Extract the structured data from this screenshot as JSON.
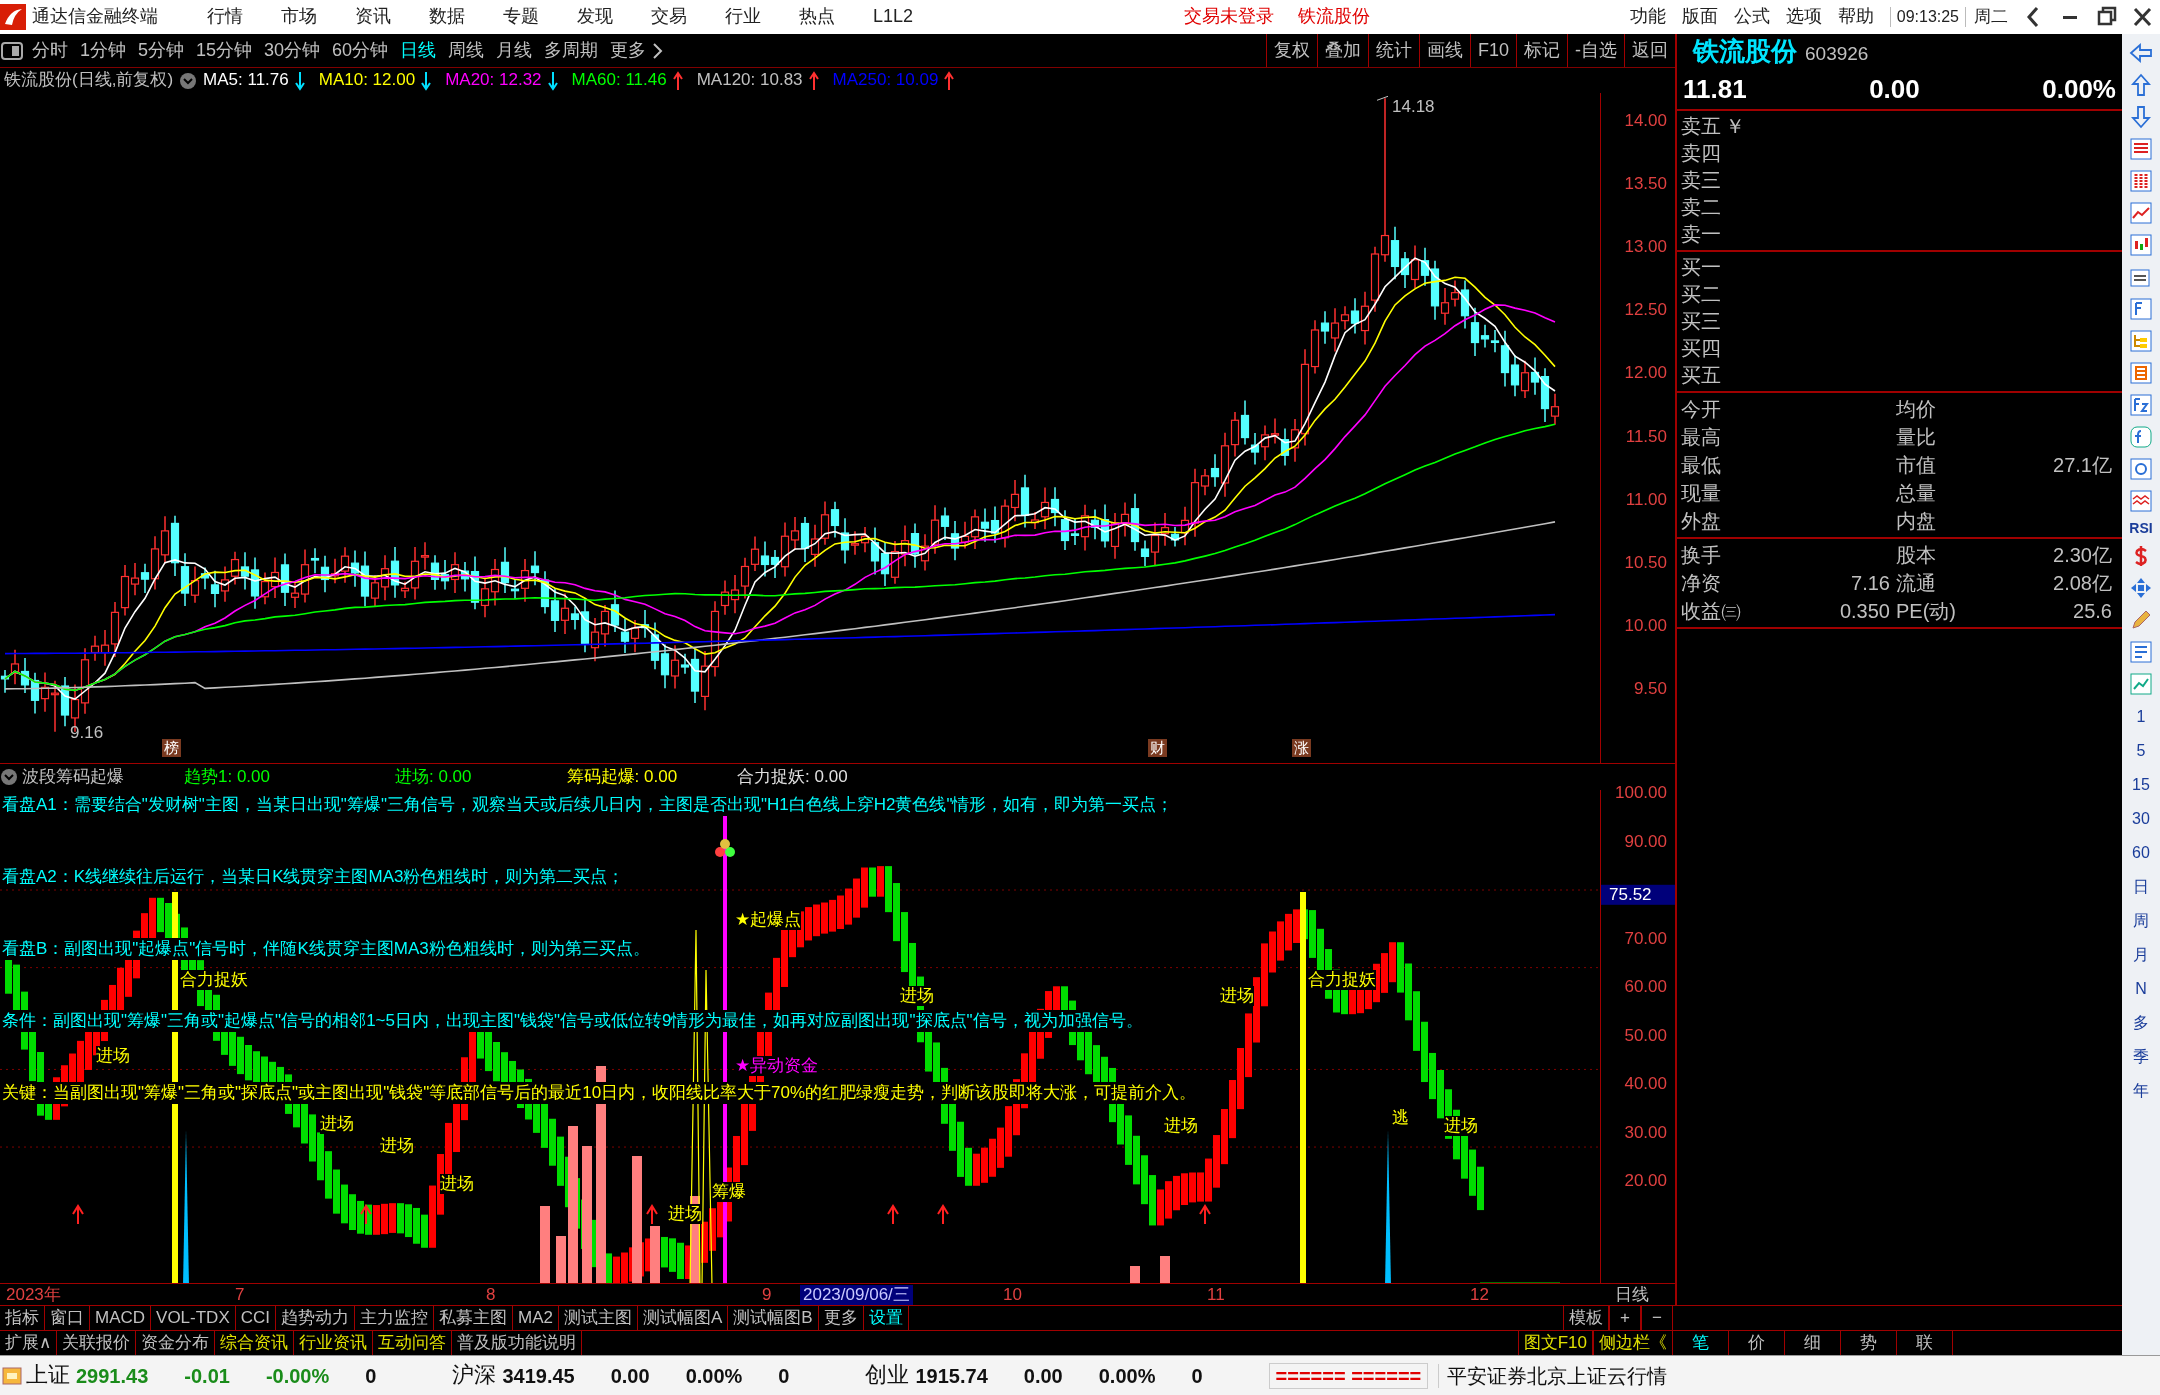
{
  "window": {
    "title": "通达信金融终端",
    "menus": [
      "行情",
      "市场",
      "资讯",
      "数据",
      "专题",
      "发现",
      "交易",
      "行业",
      "热点",
      "L1L2"
    ],
    "notices": [
      "交易未登录",
      "铁流股份"
    ],
    "right_menus": [
      "功能",
      "版面",
      "公式",
      "选项",
      "帮助"
    ],
    "time": "09:13:25",
    "weekday": "周二"
  },
  "period_tabs": [
    {
      "label": "分时",
      "selected": false
    },
    {
      "label": "1分钟",
      "selected": false
    },
    {
      "label": "5分钟",
      "selected": false
    },
    {
      "label": "15分钟",
      "selected": false
    },
    {
      "label": "30分钟",
      "selected": false
    },
    {
      "label": "60分钟",
      "selected": false
    },
    {
      "label": "日线",
      "selected": true
    },
    {
      "label": "周线",
      "selected": false
    },
    {
      "label": "月线",
      "selected": false
    },
    {
      "label": "多周期",
      "selected": false
    },
    {
      "label": "更多",
      "selected": false
    }
  ],
  "chart_tools": [
    "复权",
    "叠加",
    "统计",
    "画线",
    "F10",
    "标记",
    "-自选",
    "返回"
  ],
  "legend": {
    "title": "铁流股份(日线,前复权)",
    "averages": [
      {
        "label": "MA5: 11.76",
        "color": "#ffffff",
        "rising": false
      },
      {
        "label": "MA10: 12.00",
        "color": "#ffff00",
        "rising": false
      },
      {
        "label": "MA20: 12.32",
        "color": "#ff00ff",
        "rising": false
      },
      {
        "label": "MA60: 11.46",
        "color": "#00ff00",
        "rising": true
      },
      {
        "label": "MA120: 10.83",
        "color": "#c0c0c0",
        "rising": true
      },
      {
        "label": "MA250: 10.09",
        "color": "#0000ff",
        "rising": true
      }
    ]
  },
  "price_axis": [
    "14.00",
    "13.50",
    "13.00",
    "12.50",
    "12.00",
    "11.50",
    "11.00",
    "10.50",
    "10.00",
    "9.50"
  ],
  "high_label": "14.18",
  "low_label": "9.16",
  "event_marks": [
    "榜",
    "财",
    "涨"
  ],
  "indicator": {
    "name": "波段筹码起爆",
    "readings": [
      {
        "label": "趋势1: 0.00",
        "color": "#00ff00"
      },
      {
        "label": "进场: 0.00",
        "color": "#00ff00"
      },
      {
        "label": "筹码起爆: 0.00",
        "color": "#ffff00"
      },
      {
        "label": "合力捉妖: 0.00",
        "color": "#e0e0e0"
      }
    ],
    "notes": [
      {
        "text": "看盘A1：需要结合\"发财树\"主图，当某日出现\"筹爆\"三角信号，观察当天或后续几日内，主图是否出现\"H1白色线上穿H2黄色线\"情形，如有，即为第一买点；",
        "color": "#00ffff"
      },
      {
        "text": "看盘A2：K线继续往后运行，当某日K线贯穿主图MA3粉色粗线时，则为第二买点；",
        "color": "#00ffff"
      },
      {
        "text": "看盘B：副图出现\"起爆点\"信号时，伴随K线贯穿主图MA3粉色粗线时，则为第三买点。",
        "color": "#00ffff"
      },
      {
        "text": "条件：副图出现\"筹爆\"三角或\"起爆点\"信号的相邻1~5日内，出现主图\"钱袋\"信号或低位转9情形为最佳，如再对应副图出现\"探底点\"信号，视为加强信号。",
        "color": "#00ffff"
      },
      {
        "text": "关键：当副图出现\"筹爆\"三角或\"探底点\"或主图出现\"钱袋\"等底部信号后的最近10日内，收阳线比率大于70%的红肥绿瘦走势，判断该股即将大涨，可提前介入。",
        "color": "#ffff00"
      }
    ],
    "signals": [
      {
        "text": "合力捉妖",
        "color": "#ffff00"
      },
      {
        "text": "进场",
        "color": "#ffff00"
      },
      {
        "text": "进场",
        "color": "#ffff00"
      },
      {
        "text": "进场",
        "color": "#ffff00"
      },
      {
        "text": "进场",
        "color": "#ffff00"
      },
      {
        "text": "筹爆",
        "color": "#ffff00"
      },
      {
        "text": "进场",
        "color": "#ffff00"
      },
      {
        "text": "★起爆点",
        "color": "#ffff00"
      },
      {
        "text": "★异动资金",
        "color": "#ff00ff"
      },
      {
        "text": "进场",
        "color": "#ffff00"
      },
      {
        "text": "进场",
        "color": "#ffff00"
      },
      {
        "text": "进场",
        "color": "#ffff00"
      },
      {
        "text": "合力捉妖",
        "color": "#ffff00"
      },
      {
        "text": "逃",
        "color": "#ffff00"
      },
      {
        "text": "进场",
        "color": "#ffff00"
      }
    ],
    "axis": [
      "100.00",
      "90.00",
      "70.00",
      "60.00",
      "50.00",
      "40.00",
      "30.00",
      "20.00"
    ],
    "current": "75.52"
  },
  "date_axis": {
    "labels": [
      "2023年",
      "7",
      "8",
      "9",
      "10",
      "11",
      "12"
    ],
    "cursor_date": "2023/09/06/三",
    "period": "日线"
  },
  "bottom_tabs": [
    {
      "label": "指标",
      "kind": "tab"
    },
    {
      "label": "窗口",
      "kind": "tab"
    },
    {
      "label": "MACD",
      "kind": "tab"
    },
    {
      "label": "VOL-TDX",
      "kind": "tab"
    },
    {
      "label": "CCI",
      "kind": "tab"
    },
    {
      "label": "趋势动力",
      "kind": "tab"
    },
    {
      "label": "主力监控",
      "kind": "tab"
    },
    {
      "label": "私募主图",
      "kind": "tab"
    },
    {
      "label": "MA2",
      "kind": "tab"
    },
    {
      "label": "测试主图",
      "kind": "tab"
    },
    {
      "label": "测试幅图A",
      "kind": "tab"
    },
    {
      "label": "测试幅图B",
      "kind": "tab"
    },
    {
      "label": "更多",
      "kind": "tab"
    },
    {
      "label": "设置",
      "kind": "link"
    }
  ],
  "template_controls": [
    "模板",
    "+",
    "−"
  ],
  "info_tabs": [
    {
      "label": "扩展∧",
      "kind": "tab"
    },
    {
      "label": "关联报价",
      "kind": "tab"
    },
    {
      "label": "资金分布",
      "kind": "tab"
    },
    {
      "label": "综合资讯",
      "kind": "info"
    },
    {
      "label": "行业资讯",
      "kind": "info"
    },
    {
      "label": "互动问答",
      "kind": "info"
    },
    {
      "label": "普及版功能说明",
      "kind": "tab"
    }
  ],
  "side_links": [
    "图文F10",
    "侧边栏《"
  ],
  "panel_tabs": [
    {
      "label": "笔",
      "selected": true
    },
    {
      "label": "价",
      "selected": false
    },
    {
      "label": "细",
      "selected": false
    },
    {
      "label": "势",
      "selected": false
    },
    {
      "label": "联",
      "selected": false
    }
  ],
  "quote": {
    "name": "铁流股份",
    "code": "603926",
    "price": "11.81",
    "change": "0.00",
    "percent": "0.00%",
    "sell_levels": [
      "卖五",
      "卖四",
      "卖三",
      "卖二",
      "卖一"
    ],
    "sell_unit": "￥",
    "buy_levels": [
      "买一",
      "买二",
      "买三",
      "买四",
      "买五"
    ],
    "stats": [
      {
        "label": "今开",
        "label2": "均价"
      },
      {
        "label": "最高",
        "label2": "量比"
      },
      {
        "label": "最低",
        "label2": "市值",
        "value2": "27.1亿"
      },
      {
        "label": "现量",
        "label2": "总量"
      },
      {
        "label": "外盘",
        "label2": "内盘"
      }
    ],
    "finance": [
      {
        "label": "换手",
        "label2": "股本",
        "value2": "2.30亿"
      },
      {
        "label": "净资",
        "value": "7.16",
        "label2": "流通",
        "value2": "2.08亿"
      },
      {
        "label": "收益㈢",
        "value": "0.350",
        "label2": "PE(动)",
        "value2": "25.6"
      }
    ]
  },
  "side_toolbar": {
    "label": "RSI",
    "periods": [
      "1",
      "5",
      "15",
      "30",
      "60",
      "日",
      "周",
      "月",
      "N",
      "多",
      "季",
      "年"
    ]
  },
  "status_bar": {
    "indices": [
      {
        "name": "上证",
        "value": "2991.43",
        "change": "-0.01",
        "percent": "-0.00%",
        "volume": "0",
        "falling": true
      },
      {
        "name": "沪深",
        "value": "3419.45",
        "change": "0.00",
        "percent": "0.00%",
        "volume": "0",
        "falling": false
      },
      {
        "name": "创业",
        "value": "1915.74",
        "change": "0.00",
        "percent": "0.00%",
        "volume": "0",
        "falling": false
      }
    ],
    "signal": "====== ======",
    "source": "平安证券北京上证云行情"
  }
}
